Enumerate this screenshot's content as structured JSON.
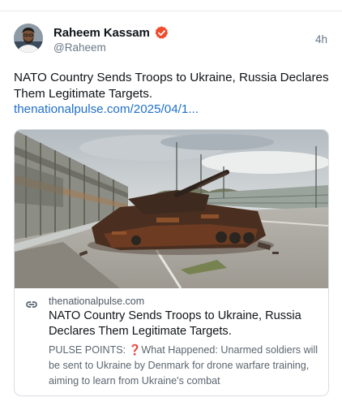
{
  "post": {
    "author_name": "Raheem Kassam",
    "author_handle": "@Raheem",
    "timestamp": "4h",
    "text": "NATO Country Sends Troops to Ukraine, Russia Declares Them Legitimate Targets.",
    "link_text": "thenationalpulse.com/2025/04/1..."
  },
  "link_card": {
    "domain": "thenationalpulse.com",
    "title": "NATO Country Sends Troops to Ukraine, Russia Declares Them Legitimate Targets.",
    "description_prefix": "PULSE POINTS: ",
    "description_mark": "❓",
    "description_body": "What Happened: Unarmed soldiers will be sent to Ukraine by Denmark for drone warfare training, aiming to learn from Ukraine's combat"
  },
  "icons": {
    "verified": "verified-badge-icon",
    "link": "link-icon"
  },
  "colors": {
    "link": "#1f6fc8",
    "verified_badge": "#f04b2a",
    "muted_text": "#687684"
  }
}
